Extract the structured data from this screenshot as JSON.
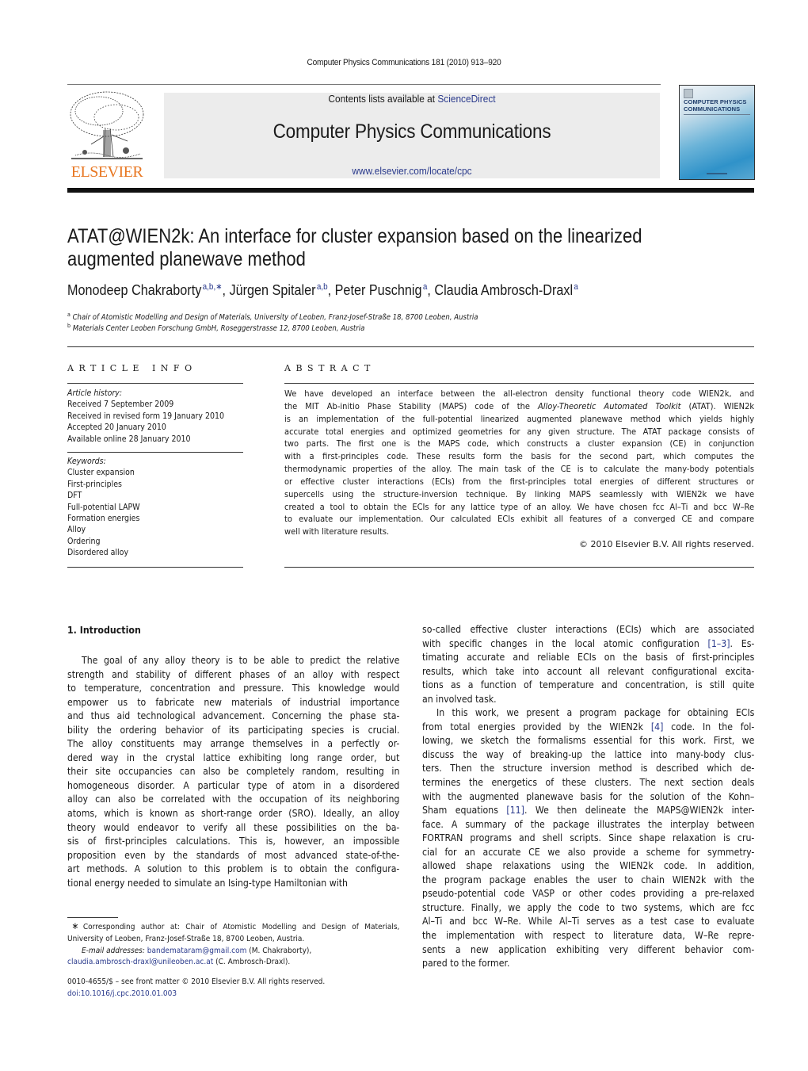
{
  "running_head": "Computer Physics Communications 181 (2010) 913–920",
  "header": {
    "publisher_logo_text": "ELSEVIER",
    "contents_prefix": "Contents lists available at ",
    "contents_link": "ScienceDirect",
    "journal_title": "Computer Physics Communications",
    "journal_url": "www.elsevier.com/locate/cpc",
    "cover_title_line1": "COMPUTER PHYSICS",
    "cover_title_line2": "COMMUNICATIONS"
  },
  "article": {
    "title_line1": "ATAT@WIEN2k: An interface for cluster expansion based on the linearized",
    "title_line2": "augmented planewave method",
    "authors": [
      {
        "name": "Monodeep Chakraborty",
        "marks": "a,b,∗",
        "sep": ", "
      },
      {
        "name": "Jürgen Spitaler",
        "marks": "a,b",
        "sep": ", "
      },
      {
        "name": "Peter Puschnig",
        "marks": "a",
        "sep": ", "
      },
      {
        "name": "Claudia Ambrosch-Draxl",
        "marks": "a",
        "sep": ""
      }
    ],
    "affiliations": [
      {
        "mark": "a",
        "text": "Chair of Atomistic Modelling and Design of Materials, University of Leoben, Franz-Josef-Straße 18, 8700 Leoben, Austria"
      },
      {
        "mark": "b",
        "text": "Materials Center Leoben Forschung GmbH, Roseggerstrasse 12, 8700 Leoben, Austria"
      }
    ]
  },
  "article_info": {
    "heading": "ARTICLE INFO",
    "history_label": "Article history:",
    "history": [
      "Received 7 September 2009",
      "Received in revised form 19 January 2010",
      "Accepted 20 January 2010",
      "Available online 28 January 2010"
    ],
    "keywords_label": "Keywords:",
    "keywords": [
      "Cluster expansion",
      "First-principles",
      "DFT",
      "Full-potential LAPW",
      "Formation energies",
      "Alloy",
      "Ordering",
      "Disordered alloy"
    ]
  },
  "abstract": {
    "heading": "ABSTRACT",
    "lines": [
      "We have developed an interface between the all-electron density functional theory code WIEN2k, and",
      "the MIT Ab-initio Phase Stability (MAPS) code of the Alloy-Theoretic Automated Toolkit (ATAT). WIEN2k",
      "is an implementation of the full-potential linearized augmented planewave method which yields highly",
      "accurate total energies and optimized geometries for any given structure. The ATAT package consists of",
      "two parts. The first one is the MAPS code, which constructs a cluster expansion (CE) in conjunction",
      "with a first-principles code. These results form the basis for the second part, which computes the",
      "thermodynamic properties of the alloy. The main task of the CE is to calculate the many-body potentials",
      "or effective cluster interactions (ECIs) from the first-principles total energies of different structures or",
      "supercells using the structure-inversion technique. By linking MAPS seamlessly with WIEN2k we have",
      "created a tool to obtain the ECIs for any lattice type of an alloy. We have chosen fcc Al–Ti and bcc W–Re",
      "to evaluate our implementation. Our calculated ECIs exhibit all features of a converged CE and compare",
      "well with literature results."
    ],
    "copyright": "© 2010 Elsevier B.V. All rights reserved."
  },
  "section": {
    "heading": "1.  Introduction",
    "left_lines": [
      "The goal of any alloy theory is to be able to predict the relative",
      "strength and stability of different phases of an alloy with respect",
      "to temperature, concentration and pressure. This knowledge would",
      "empower us to fabricate new materials of industrial importance",
      "and thus aid technological advancement. Concerning the phase sta-",
      "bility the ordering behavior of its participating species is crucial.",
      "The alloy constituents may arrange themselves in a perfectly or-",
      "dered way in the crystal lattice exhibiting long range order, but",
      "their site occupancies can also be completely random, resulting in",
      "homogeneous disorder. A particular type of atom in a disordered",
      "alloy can also be correlated with the occupation of its neighboring",
      "atoms, which is known as short-range order (SRO). Ideally, an alloy",
      "theory would endeavor to verify all these possibilities on the ba-",
      "sis of first-principles calculations. This is, however, an impossible",
      "proposition even by the standards of most advanced state-of-the-",
      "art methods. A solution to this problem is to obtain the configura-",
      "tional energy needed to simulate an Ising-type Hamiltonian with"
    ],
    "right_lines": [
      "so-called effective cluster interactions (ECIs) which are associated",
      "with specific changes in the local atomic configuration [1–3]. Es-",
      "timating accurate and reliable ECIs on the basis of first-principles",
      "results, which take into account all relevant configurational excita-",
      "tions as a function of temperature and concentration, is still quite",
      "an involved task.",
      "In this work, we present a program package for obtaining ECIs",
      "from total energies provided by the WIEN2k [4] code. In the fol-",
      "lowing, we sketch the formalisms essential for this work. First, we",
      "discuss the way of breaking-up the lattice into many-body clus-",
      "ters. Then the structure inversion method is described which de-",
      "termines the energetics of these clusters. The next section deals",
      "with the augmented planewave basis for the solution of the Kohn–",
      "Sham equations [11]. We then delineate the MAPS@WIEN2k inter-",
      "face. A summary of the package illustrates the interplay between",
      "FORTRAN programs and shell scripts. Since shape relaxation is cru-",
      "cial for an accurate CE we also provide a scheme for symmetry-",
      "allowed shape relaxations using the WIEN2k code. In addition,",
      "the program package enables the user to chain WIEN2k with the",
      "pseudo-potential code VASP or other codes providing a pre-relaxed",
      "structure. Finally, we apply the code to two systems, which are fcc",
      "Al–Ti and bcc W–Re. While Al–Ti serves as a test case to evaluate",
      "the implementation with respect to literature data, W–Re repre-",
      "sents a new application exhibiting very different behavior com-",
      "pared to the former."
    ]
  },
  "footnotes": {
    "star": "∗",
    "corresponding_line1": "Corresponding author at: Chair of Atomistic Modelling and Design of Materials,",
    "corresponding_line2": "University of Leoben, Franz-Josef-Straße 18, 8700 Leoben, Austria.",
    "email_label": "E-mail addresses:",
    "email1": "bandemataram@gmail.com",
    "email1_who": " (M. Chakraborty),",
    "email2": "claudia.ambrosch-draxl@unileoben.ac.at",
    "email2_who": " (C. Ambrosch-Draxl).",
    "front_matter": "0010-4655/$ – see front matter  © 2010 Elsevier B.V. All rights reserved.",
    "doi": "doi:10.1016/j.cpc.2010.01.003"
  }
}
